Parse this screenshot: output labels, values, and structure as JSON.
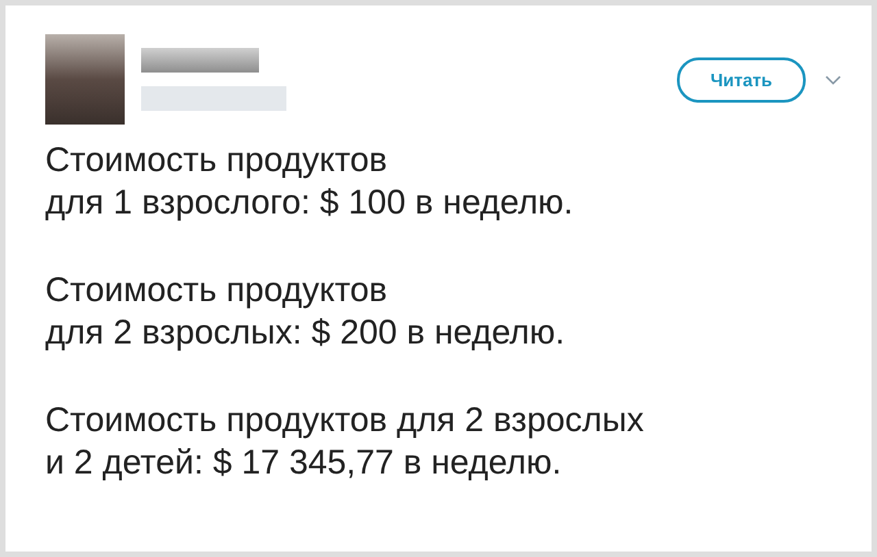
{
  "tweet": {
    "follow_button": "Читать",
    "paragraphs": [
      {
        "lines": [
          "Стоимость продуктов",
          "для 1 взрослого: $ 100 в неделю."
        ]
      },
      {
        "lines": [
          "Стоимость продуктов",
          "для 2 взрослых: $ 200 в неделю."
        ]
      },
      {
        "lines": [
          "Стоимость продуктов для 2 взрослых",
          "и 2 детей: $ 17 345,77 в неделю."
        ]
      }
    ]
  }
}
